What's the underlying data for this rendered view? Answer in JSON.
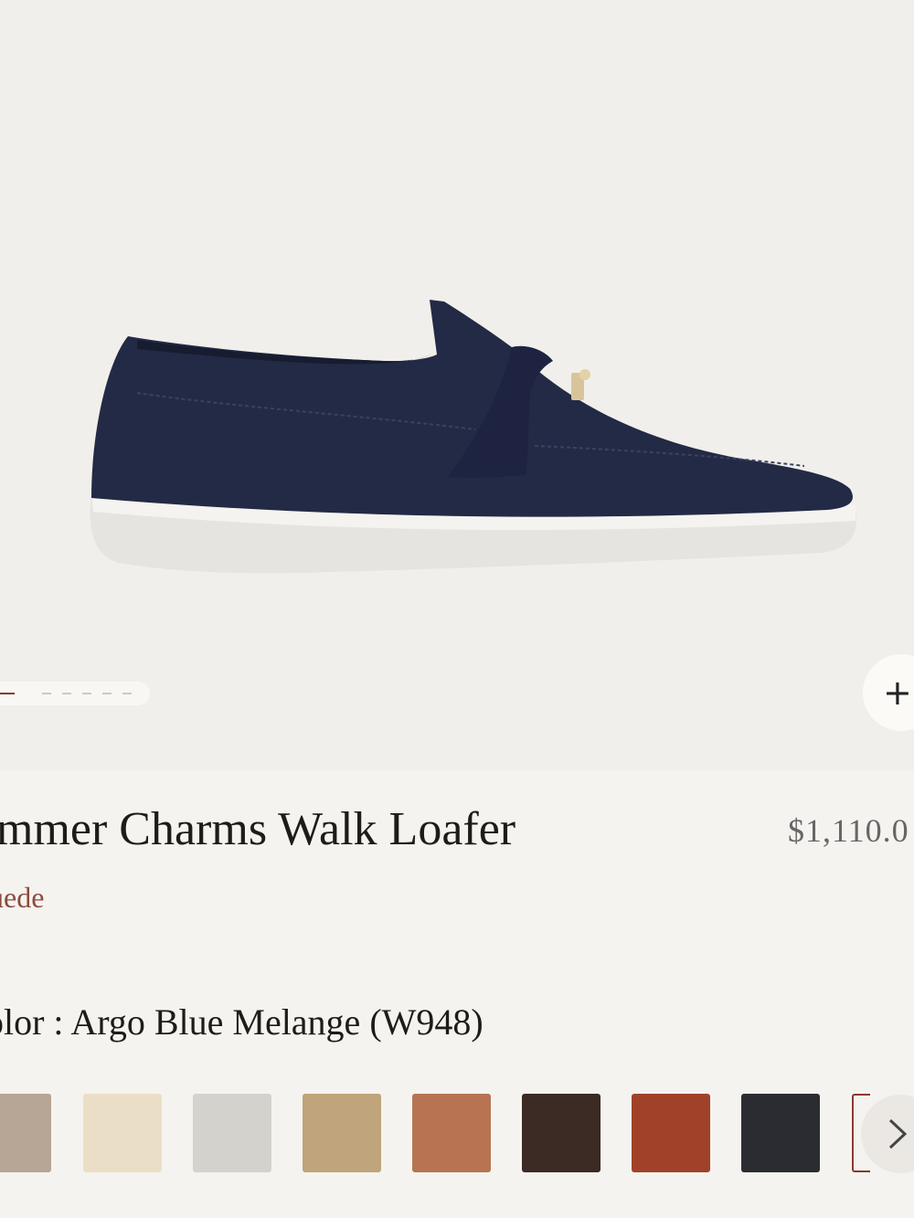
{
  "product": {
    "title": "ummer Charms Walk Loafer",
    "price": "$1,110.0",
    "material": "uede",
    "color_line": "olor : Argo Blue Melange (W948)"
  },
  "gallery": {
    "current_index": 1,
    "total_images": 7
  },
  "colors": {
    "accent": "#8a3a32",
    "shoe": "#232a45",
    "swatches": [
      "#b7a595",
      "#eadfc6",
      "#d4d2cd",
      "#bfa47c",
      "#b87352",
      "#3c2a24",
      "#a2412a",
      "#2a2c31"
    ]
  },
  "icons": {
    "zoom": "plus-icon",
    "next": "chevron-right-icon"
  }
}
